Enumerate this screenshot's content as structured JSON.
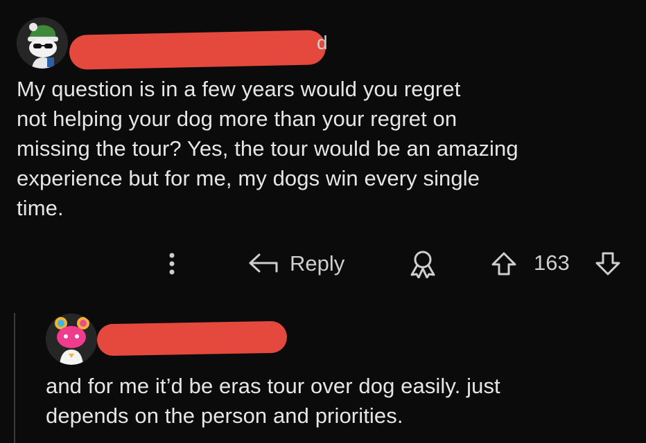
{
  "comment": {
    "author_trailing_char": "d",
    "lines": [
      "My question is in a few years would you regret",
      "not helping your dog more than your regret on",
      "missing the tour? Yes, the tour would be an amazing",
      "experience but for me, my dogs win every single",
      "time."
    ],
    "actions": {
      "more_icon": "more-vertical-icon",
      "reply_label": "Reply",
      "reply_icon": "reply-arrow-icon",
      "award_icon": "award-icon",
      "upvote_icon": "upvote-arrow-icon",
      "vote_count": "163",
      "downvote_icon": "downvote-arrow-icon"
    }
  },
  "reply": {
    "lines": [
      "and for me it’d be eras tour over dog easily. just",
      "depends on the person and priorities."
    ]
  },
  "colors": {
    "background": "#0b0b0b",
    "redaction": "#e5483d",
    "text": "#e6e6e6",
    "thread_line": "#3a3a3a"
  }
}
